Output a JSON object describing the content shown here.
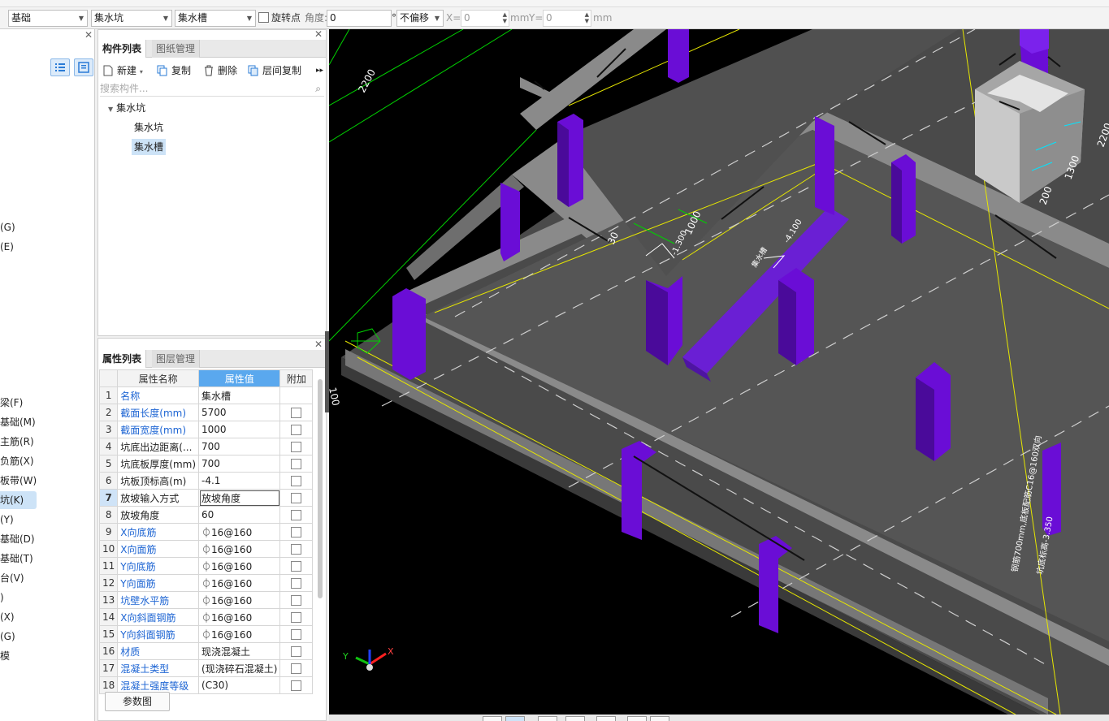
{
  "toolbar": {
    "floor_value": "基础",
    "category_value": "集水坑",
    "component_value": "集水槽",
    "rotate_label": "旋转点",
    "angle_label": "角度:",
    "angle_value": "0",
    "degree_unit": "°",
    "offset_value": "不偏移",
    "x_label": "X=",
    "x_value": "0",
    "mm_label": "mm",
    "y_label": "Y=",
    "y_value": "0"
  },
  "nav": {
    "items": [
      "(G)",
      "(E)",
      "梁(F)",
      "基础(M)",
      "主筋(R)",
      "负筋(X)",
      "板带(W)",
      "坑(K)",
      "(Y)",
      "基础(D)",
      "基础(T)",
      "台(V)",
      ")",
      "(X)",
      "(G)",
      "模"
    ],
    "selected_index": 7
  },
  "component_list": {
    "tabs": [
      "构件列表",
      "图纸管理"
    ],
    "actions": {
      "new": "新建",
      "copy": "复制",
      "delete": "删除",
      "floor_copy": "层间复制"
    },
    "search_placeholder": "搜索构件...",
    "tree": {
      "parent": "集水坑",
      "children": [
        "集水坑",
        "集水槽"
      ],
      "selected": "集水槽"
    }
  },
  "properties": {
    "tabs": [
      "属性列表",
      "图层管理"
    ],
    "headers": {
      "name": "属性名称",
      "value": "属性值",
      "extra": "附加"
    },
    "rows": [
      {
        "n": "1",
        "name": "名称",
        "value": "集水槽",
        "blue": true,
        "check": false
      },
      {
        "n": "2",
        "name": "截面长度(mm)",
        "value": "5700",
        "blue": true,
        "check": true
      },
      {
        "n": "3",
        "name": "截面宽度(mm)",
        "value": "1000",
        "blue": true,
        "check": true
      },
      {
        "n": "4",
        "name": "坑底出边距离(...",
        "value": "700",
        "blue": false,
        "check": true
      },
      {
        "n": "5",
        "name": "坑底板厚度(mm)",
        "value": "700",
        "blue": false,
        "check": true
      },
      {
        "n": "6",
        "name": "坑板顶标高(m)",
        "value": "-4.1",
        "blue": false,
        "check": true
      },
      {
        "n": "7",
        "name": "放坡输入方式",
        "value": "放坡角度",
        "blue": false,
        "check": true
      },
      {
        "n": "8",
        "name": "放坡角度",
        "value": "60",
        "blue": false,
        "check": true
      },
      {
        "n": "9",
        "name": "X向底筋",
        "value": "⏀16@160",
        "blue": true,
        "check": true
      },
      {
        "n": "10",
        "name": "X向面筋",
        "value": "⏀16@160",
        "blue": true,
        "check": true
      },
      {
        "n": "11",
        "name": "Y向底筋",
        "value": "⏀16@160",
        "blue": true,
        "check": true
      },
      {
        "n": "12",
        "name": "Y向面筋",
        "value": "⏀16@160",
        "blue": true,
        "check": true
      },
      {
        "n": "13",
        "name": "坑壁水平筋",
        "value": "⏀16@160",
        "blue": true,
        "check": true
      },
      {
        "n": "14",
        "name": "X向斜面钢筋",
        "value": "⏀16@160",
        "blue": true,
        "check": true
      },
      {
        "n": "15",
        "name": "Y向斜面钢筋",
        "value": "⏀16@160",
        "blue": true,
        "check": true
      },
      {
        "n": "16",
        "name": "材质",
        "value": "现浇混凝土",
        "blue": true,
        "check": true
      },
      {
        "n": "17",
        "name": "混凝土类型",
        "value": "(现浇碎石混凝土)",
        "blue": true,
        "check": true
      },
      {
        "n": "18",
        "name": "混凝土强度等级",
        "value": "(C30)",
        "blue": true,
        "check": true
      }
    ],
    "selected_row": "7",
    "param_button": "参数图"
  },
  "viewport": {
    "dims": [
      "2200",
      "100",
      "1300",
      "200",
      "2200",
      "30",
      "1000"
    ],
    "elevations": [
      "-4.100",
      "-1.300",
      "-3.350"
    ],
    "annotations": [
      "集水槽",
      "钢筋700mm,底板配筋C16@160双向",
      "坑底标高-3.350"
    ],
    "axes": {
      "x": "X",
      "y": "Y",
      "z": "Z"
    },
    "colors": {
      "floor": "#5b5b5b",
      "wall": "#8a8a8a",
      "column": "#6a0dd6",
      "pit": "#6a1fd4",
      "grid": "#00d000",
      "outline": "#e6e600"
    }
  }
}
